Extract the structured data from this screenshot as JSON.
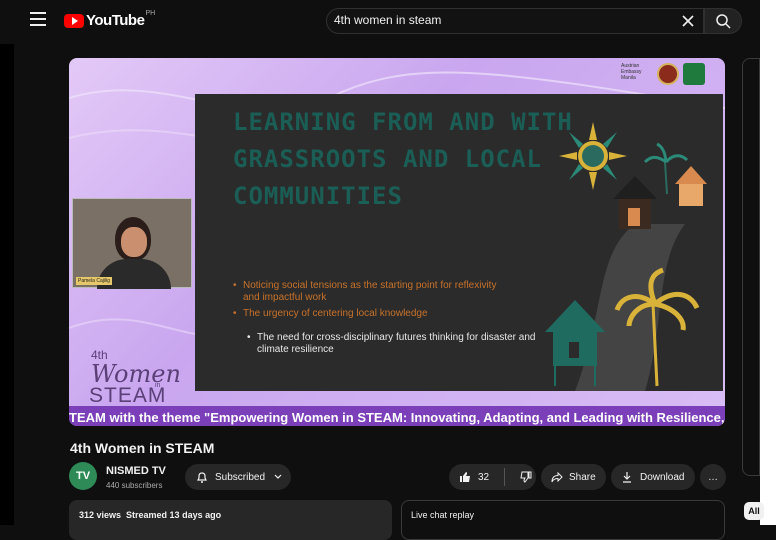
{
  "header": {
    "logo_text": "YouTube",
    "logo_region": "PH",
    "search_value": "4th women in steam"
  },
  "video": {
    "slide_title": "Learning from and with grassroots and local communities",
    "bullets": [
      "Noticing social tensions as the starting point for reflexivity and impactful work",
      "The urgency of centering local knowledge",
      "The need for cross-disciplinary futures thinking for disaster and climate resilience"
    ],
    "speaker_name": "Pamela Cajilig",
    "partner_text": "Austrian Embassy Manila",
    "brand_4th": "4th",
    "brand_women": "Women",
    "brand_in": "in",
    "brand_steam": "STEAM",
    "ticker": "TEAM with the theme \"Empowering Women in STEAM: Innovating, Adapting, and Leading with Resilience,\""
  },
  "details": {
    "title": "4th Women in STEAM",
    "channel_avatar": "TV",
    "channel_name": "NISMED TV",
    "subscribers": "440 subscribers",
    "subscribed_label": "Subscribed",
    "like_count": "32",
    "share_label": "Share",
    "download_label": "Download",
    "more_label": "…",
    "views_line": "312 views  Streamed 13 days ago",
    "chat_replay": "Live chat replay",
    "all_chip": "All"
  },
  "colors": {
    "background": "#0f0f0f",
    "brand_red": "#ff0000",
    "slide_teal": "#1a5e55",
    "ticker_purple": "#7c3fba"
  }
}
